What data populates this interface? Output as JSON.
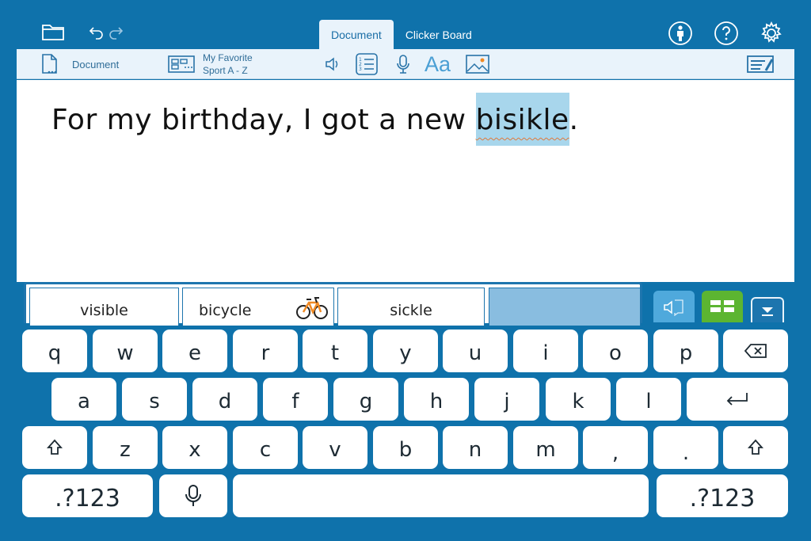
{
  "header": {
    "tabs": [
      {
        "label": "Document",
        "active": true
      },
      {
        "label": "Clicker Board",
        "active": false
      }
    ],
    "icons": [
      "folder-icon",
      "undo-icon",
      "redo-icon",
      "person-icon",
      "help-icon",
      "settings-icon"
    ]
  },
  "toolbar": {
    "document_label": "Document",
    "wordbank_line1": "My Favorite",
    "wordbank_line2": "Sport A - Z",
    "font_label": "Aa"
  },
  "document": {
    "text_before": "For my birthday, I got a new ",
    "highlighted_word": "bisikle",
    "text_after": "."
  },
  "predictions": [
    {
      "word": "visible",
      "has_image": false
    },
    {
      "word": "bicycle",
      "has_image": true
    },
    {
      "word": "sickle",
      "has_image": false
    },
    {
      "word": "",
      "has_image": false
    }
  ],
  "keyboard": {
    "row1": [
      "q",
      "w",
      "e",
      "r",
      "t",
      "y",
      "u",
      "i",
      "o",
      "p"
    ],
    "row2": [
      "a",
      "s",
      "d",
      "f",
      "g",
      "h",
      "j",
      "k",
      "l"
    ],
    "row3": [
      "z",
      "x",
      "c",
      "v",
      "b",
      "n",
      "m",
      ",",
      "."
    ],
    "symbols_label": ".?123"
  },
  "colors": {
    "background": "#0f72ab",
    "toolbar": "#e9f3fb",
    "highlight": "#a8d6ec",
    "green_button": "#5cb531",
    "light_blue_button": "#4fa9dc"
  }
}
